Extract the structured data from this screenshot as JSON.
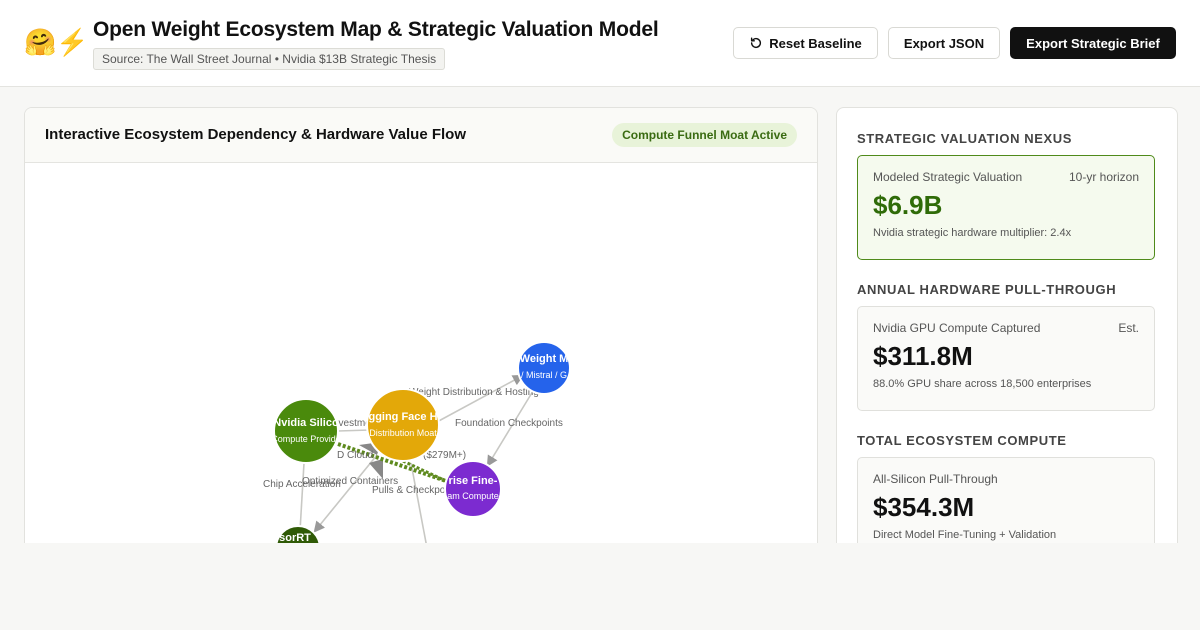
{
  "header": {
    "emoji": "🤗⚡",
    "title": "Open Weight Ecosystem Map & Strategic Valuation Model",
    "source": "Source: The Wall Street Journal • Nvidia $13B Strategic Thesis",
    "buttons": {
      "reset": "Reset Baseline",
      "export_json": "Export JSON",
      "export_brief": "Export Strategic Brief"
    }
  },
  "ecosystem_panel": {
    "title": "Interactive Ecosystem Dependency & Hardware Value Flow",
    "badge": "Compute Funnel Moat Active",
    "nodes": [
      {
        "id": "nvidia",
        "title": "Nvidia Silico",
        "subtitle": "Compute Provide",
        "color": "#4a8a0c"
      },
      {
        "id": "hf",
        "title": "gging Face H",
        "subtitle": "Distribution Moat",
        "color": "#e3a809"
      },
      {
        "id": "openweight",
        "title": "Weight M",
        "subtitle": "/ Mistral / G",
        "color": "#2563eb"
      },
      {
        "id": "enterprise",
        "title": "rise Fine-",
        "subtitle": "am Compute",
        "color": "#7c2bd0"
      },
      {
        "id": "tensorrt",
        "title": "sorRT",
        "subtitle": "",
        "color": "#2f5a06"
      }
    ],
    "edge_labels": {
      "weight_distribution": "Weight Distribution & Hosting",
      "foundation_checkpoints": "Foundation Checkpoints",
      "investment": "nvestment",
      "cloud": "D Cloud",
      "cloud_value": "($279M+)",
      "optimized_containers": "Optimized Containers",
      "chip_acceleration": "Chip Acceleration",
      "pulls_checkpoints": "Pulls & Checkpo"
    }
  },
  "valuation_panel": {
    "sections": [
      {
        "title": "Strategic Valuation Nexus",
        "label": "Modeled Strategic Valuation",
        "tag": "10-yr horizon",
        "value": "$6.9B",
        "note": "Nvidia strategic hardware multiplier: 2.4x"
      },
      {
        "title": "Annual Hardware Pull-Through",
        "label": "Nvidia GPU Compute Captured",
        "tag": "Est.",
        "value": "$311.8M",
        "note": "88.0% GPU share across 18,500 enterprises"
      },
      {
        "title": "Total Ecosystem Compute",
        "label": "All-Silicon Pull-Through",
        "tag": "",
        "value": "$354.3M",
        "note": "Direct Model Fine-Tuning + Validation"
      }
    ]
  },
  "colors": {
    "accent_green": "#4a8a0c",
    "hub_gold": "#e3a809",
    "open_blue": "#2563eb",
    "enterprise_purple": "#7c2bd0",
    "funnel_edge": "#5e8a1e"
  }
}
